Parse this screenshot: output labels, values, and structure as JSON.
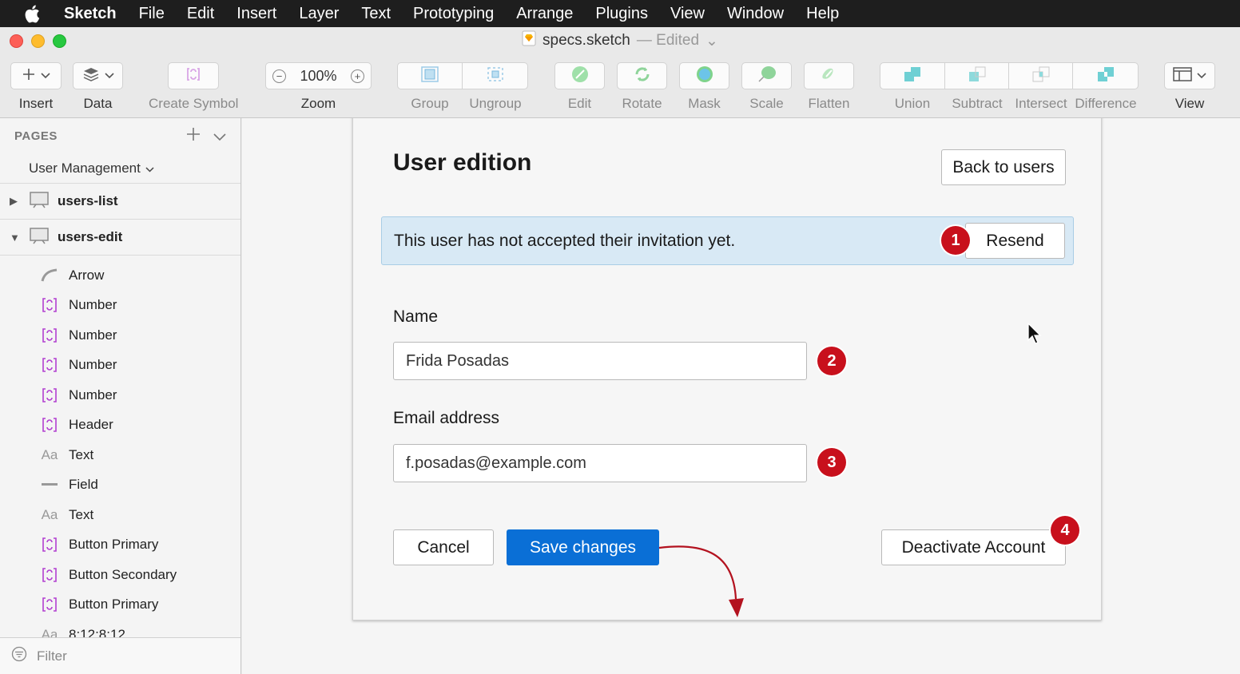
{
  "menubar": {
    "app": "Sketch",
    "items": [
      "File",
      "Edit",
      "Insert",
      "Layer",
      "Text",
      "Prototyping",
      "Arrange",
      "Plugins",
      "View",
      "Window",
      "Help"
    ]
  },
  "window": {
    "title": "specs.sketch",
    "status": "— Edited"
  },
  "toolbar": {
    "insert": "Insert",
    "data": "Data",
    "create_symbol": "Create Symbol",
    "zoom_label": "Zoom",
    "zoom_value": "100%",
    "group": "Group",
    "ungroup": "Ungroup",
    "edit": "Edit",
    "rotate": "Rotate",
    "mask": "Mask",
    "scale": "Scale",
    "flatten": "Flatten",
    "union": "Union",
    "subtract": "Subtract",
    "intersect": "Intersect",
    "difference": "Difference",
    "view": "View"
  },
  "sidebar": {
    "pages_title": "PAGES",
    "current_page": "User Management",
    "artboards": [
      {
        "name": "users-list",
        "expanded": false
      },
      {
        "name": "users-edit",
        "expanded": true
      }
    ],
    "layers": [
      {
        "icon": "arrow-shape-icon",
        "name": "Arrow"
      },
      {
        "icon": "symbol-icon",
        "name": "Number"
      },
      {
        "icon": "symbol-icon",
        "name": "Number"
      },
      {
        "icon": "symbol-icon",
        "name": "Number"
      },
      {
        "icon": "symbol-icon",
        "name": "Number"
      },
      {
        "icon": "symbol-icon",
        "name": "Header"
      },
      {
        "icon": "text-layer-icon",
        "name": "Text"
      },
      {
        "icon": "line-icon",
        "name": "Field"
      },
      {
        "icon": "text-layer-icon",
        "name": "Text"
      },
      {
        "icon": "symbol-icon",
        "name": "Button Primary"
      },
      {
        "icon": "symbol-icon",
        "name": "Button Secondary"
      },
      {
        "icon": "symbol-icon",
        "name": "Button Primary"
      },
      {
        "icon": "text-layer-icon",
        "name": "8:12:8:12"
      }
    ],
    "filter_placeholder": "Filter"
  },
  "artboard": {
    "title": "User edition",
    "back_button": "Back to users",
    "alert_text": "This user has not accepted their invitation yet.",
    "resend_button": "Resend",
    "name_label": "Name",
    "name_value": "Frida Posadas",
    "email_label": "Email address",
    "email_value": "f.posadas@example.com",
    "cancel_button": "Cancel",
    "save_button": "Save changes",
    "deactivate_button": "Deactivate Account",
    "markers": [
      "1",
      "2",
      "3",
      "4"
    ]
  },
  "colors": {
    "primary": "#0a6fd6",
    "marker": "#c8101c",
    "alert_bg": "#d8e9f5",
    "symbol_icon": "#b23fd0"
  }
}
